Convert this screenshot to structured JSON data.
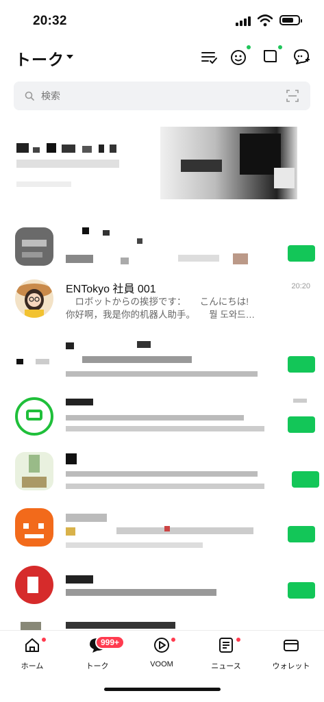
{
  "status_bar": {
    "time": "20:32"
  },
  "header": {
    "title": "トーク"
  },
  "search": {
    "placeholder": "検索"
  },
  "chats": [
    {
      "name": "ENTokyo 社員 001",
      "time": "20:20",
      "message_line1": "　ロボットからの挨拶です：　　こんにちは!",
      "message_line2": "你好啊，我是你的机器人助手。　　뭘 도와드…"
    }
  ],
  "tabs": [
    {
      "label": "ホーム",
      "icon": "home-icon"
    },
    {
      "label": "トーク",
      "icon": "chat-icon",
      "badge": "999+"
    },
    {
      "label": "VOOM",
      "icon": "voom-icon"
    },
    {
      "label": "ニュース",
      "icon": "news-icon"
    },
    {
      "label": "ウォレット",
      "icon": "wallet-icon"
    }
  ],
  "colors": {
    "accent_green": "#13c658",
    "badge_red": "#ff3b4f"
  }
}
